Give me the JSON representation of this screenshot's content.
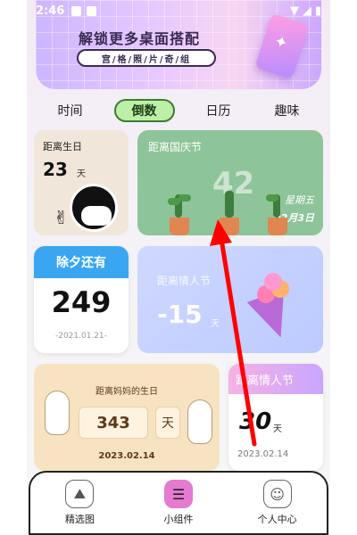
{
  "status": {
    "time": "2:46"
  },
  "banner": {
    "title": "解锁更多桌面搭配",
    "pill": "宫/格/照/片/奇/组"
  },
  "tabs": [
    {
      "label": "时间",
      "active": false
    },
    {
      "label": "倒数",
      "active": true
    },
    {
      "label": "日历",
      "active": false
    },
    {
      "label": "趣味",
      "active": false
    }
  ],
  "cards": {
    "birthday": {
      "label": "距离生日",
      "value": "23",
      "unit": "天"
    },
    "national": {
      "label": "距离国庆节",
      "value": "42",
      "weekday": "星期五",
      "date": "02月3日"
    },
    "newyear": {
      "label": "除夕还有",
      "value": "249",
      "date": "-2021.01.21-"
    },
    "valentine": {
      "label": "距离情人节",
      "value": "-15",
      "unit": "天"
    },
    "pinkcard": {
      "label": "距离妈妈的生日",
      "value": "343",
      "unit": "天",
      "date": "2023.02.14"
    },
    "valentine2": {
      "label": "距离情人节",
      "value": "30",
      "unit": "天",
      "date": "2023.02.14"
    }
  },
  "bottomnav": [
    {
      "label": "精选图",
      "icon": "image-icon",
      "active": false
    },
    {
      "label": "小组件",
      "icon": "widget-icon",
      "active": true
    },
    {
      "label": "个人中心",
      "icon": "user-icon",
      "active": false
    }
  ],
  "colors": {
    "accent": "#e57ad0",
    "arrow": "#ff0000"
  }
}
